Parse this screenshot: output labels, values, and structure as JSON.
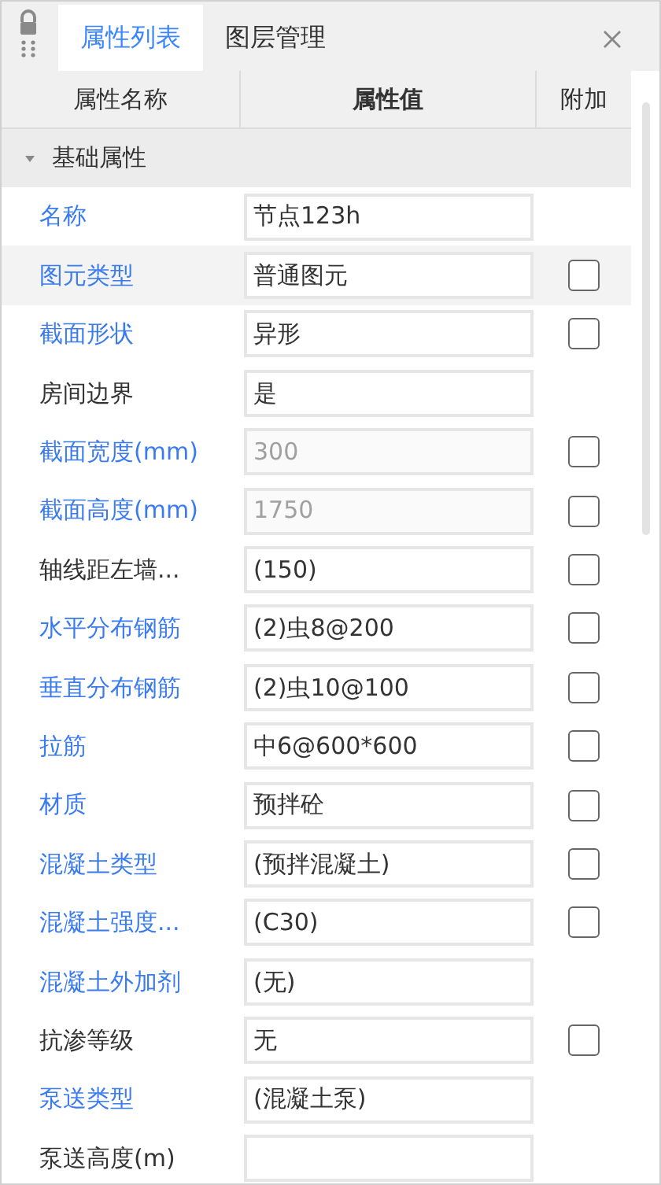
{
  "tabs": [
    {
      "label": "属性列表",
      "selected": true
    },
    {
      "label": "图层管理",
      "selected": false
    }
  ],
  "table": {
    "columns": [
      "属性名称",
      "属性值",
      "附加"
    ],
    "group": {
      "label": "基础属性",
      "expanded": true
    },
    "rows": [
      {
        "name": "名称",
        "linked": true,
        "value": "节点123h",
        "disabled": false,
        "selected": false
      },
      {
        "name": "图元类型",
        "linked": true,
        "value": "普通图元",
        "disabled": false,
        "selected": true,
        "attach": {
          "checked": false
        }
      },
      {
        "name": "截面形状",
        "linked": true,
        "value": "异形",
        "disabled": false,
        "selected": false,
        "attach": {
          "checked": false
        }
      },
      {
        "name": "房间边界",
        "linked": false,
        "value": "是",
        "disabled": false,
        "selected": false
      },
      {
        "name": "截面宽度(mm)",
        "linked": true,
        "value": "300",
        "disabled": true,
        "selected": false,
        "attach": {
          "checked": false
        }
      },
      {
        "name": "截面高度(mm)",
        "linked": true,
        "value": "1750",
        "disabled": true,
        "selected": false,
        "attach": {
          "checked": false
        }
      },
      {
        "name": "轴线距左墙...",
        "linked": false,
        "value": "(150)",
        "disabled": false,
        "selected": false,
        "attach": {
          "checked": false
        }
      },
      {
        "name": "水平分布钢筋",
        "linked": true,
        "value": "(2)虫8@200",
        "disabled": false,
        "selected": false,
        "attach": {
          "checked": false
        }
      },
      {
        "name": "垂直分布钢筋",
        "linked": true,
        "value": "(2)虫10@100",
        "disabled": false,
        "selected": false,
        "attach": {
          "checked": false
        }
      },
      {
        "name": "拉筋",
        "linked": true,
        "value": "中6@600*600",
        "disabled": false,
        "selected": false,
        "attach": {
          "checked": false
        }
      },
      {
        "name": "材质",
        "linked": true,
        "value": "预拌砼",
        "disabled": false,
        "selected": false,
        "attach": {
          "checked": false
        }
      },
      {
        "name": "混凝土类型",
        "linked": true,
        "value": "(预拌混凝土)",
        "disabled": false,
        "selected": false,
        "attach": {
          "checked": false
        }
      },
      {
        "name": "混凝土强度...",
        "linked": true,
        "value": "(C30)",
        "disabled": false,
        "selected": false,
        "attach": {
          "checked": false
        }
      },
      {
        "name": "混凝土外加剂",
        "linked": true,
        "value": "(无)",
        "disabled": false,
        "selected": false
      },
      {
        "name": "抗渗等级",
        "linked": false,
        "value": "无",
        "disabled": false,
        "selected": false,
        "attach": {
          "checked": false
        }
      },
      {
        "name": "泵送类型",
        "linked": true,
        "value": "(混凝土泵)",
        "disabled": false,
        "selected": false
      },
      {
        "name": "泵送高度(m)",
        "linked": false,
        "selected": false
      }
    ]
  }
}
